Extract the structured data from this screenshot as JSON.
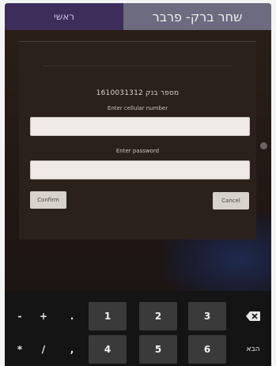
{
  "topbar": {
    "tab_left": "ראשי",
    "tab_right": "שחר ברק- פרבר"
  },
  "dialog": {
    "account_number": "1610031312 מספר בנק",
    "cellular_label": "Enter cellular number",
    "cellular_value": "",
    "password_label": "Enter password",
    "password_value": "",
    "confirm_label": "Confirm",
    "cancel_label": "Cancel"
  },
  "keyboard": {
    "row1": {
      "symbols": [
        "-",
        "+",
        "."
      ],
      "digits": [
        "1",
        "2",
        "3"
      ],
      "action_icon": "backspace-icon"
    },
    "row2": {
      "symbols": [
        "*",
        "/",
        ","
      ],
      "digits": [
        "4",
        "5",
        "6"
      ],
      "action_label": "הבא"
    }
  }
}
